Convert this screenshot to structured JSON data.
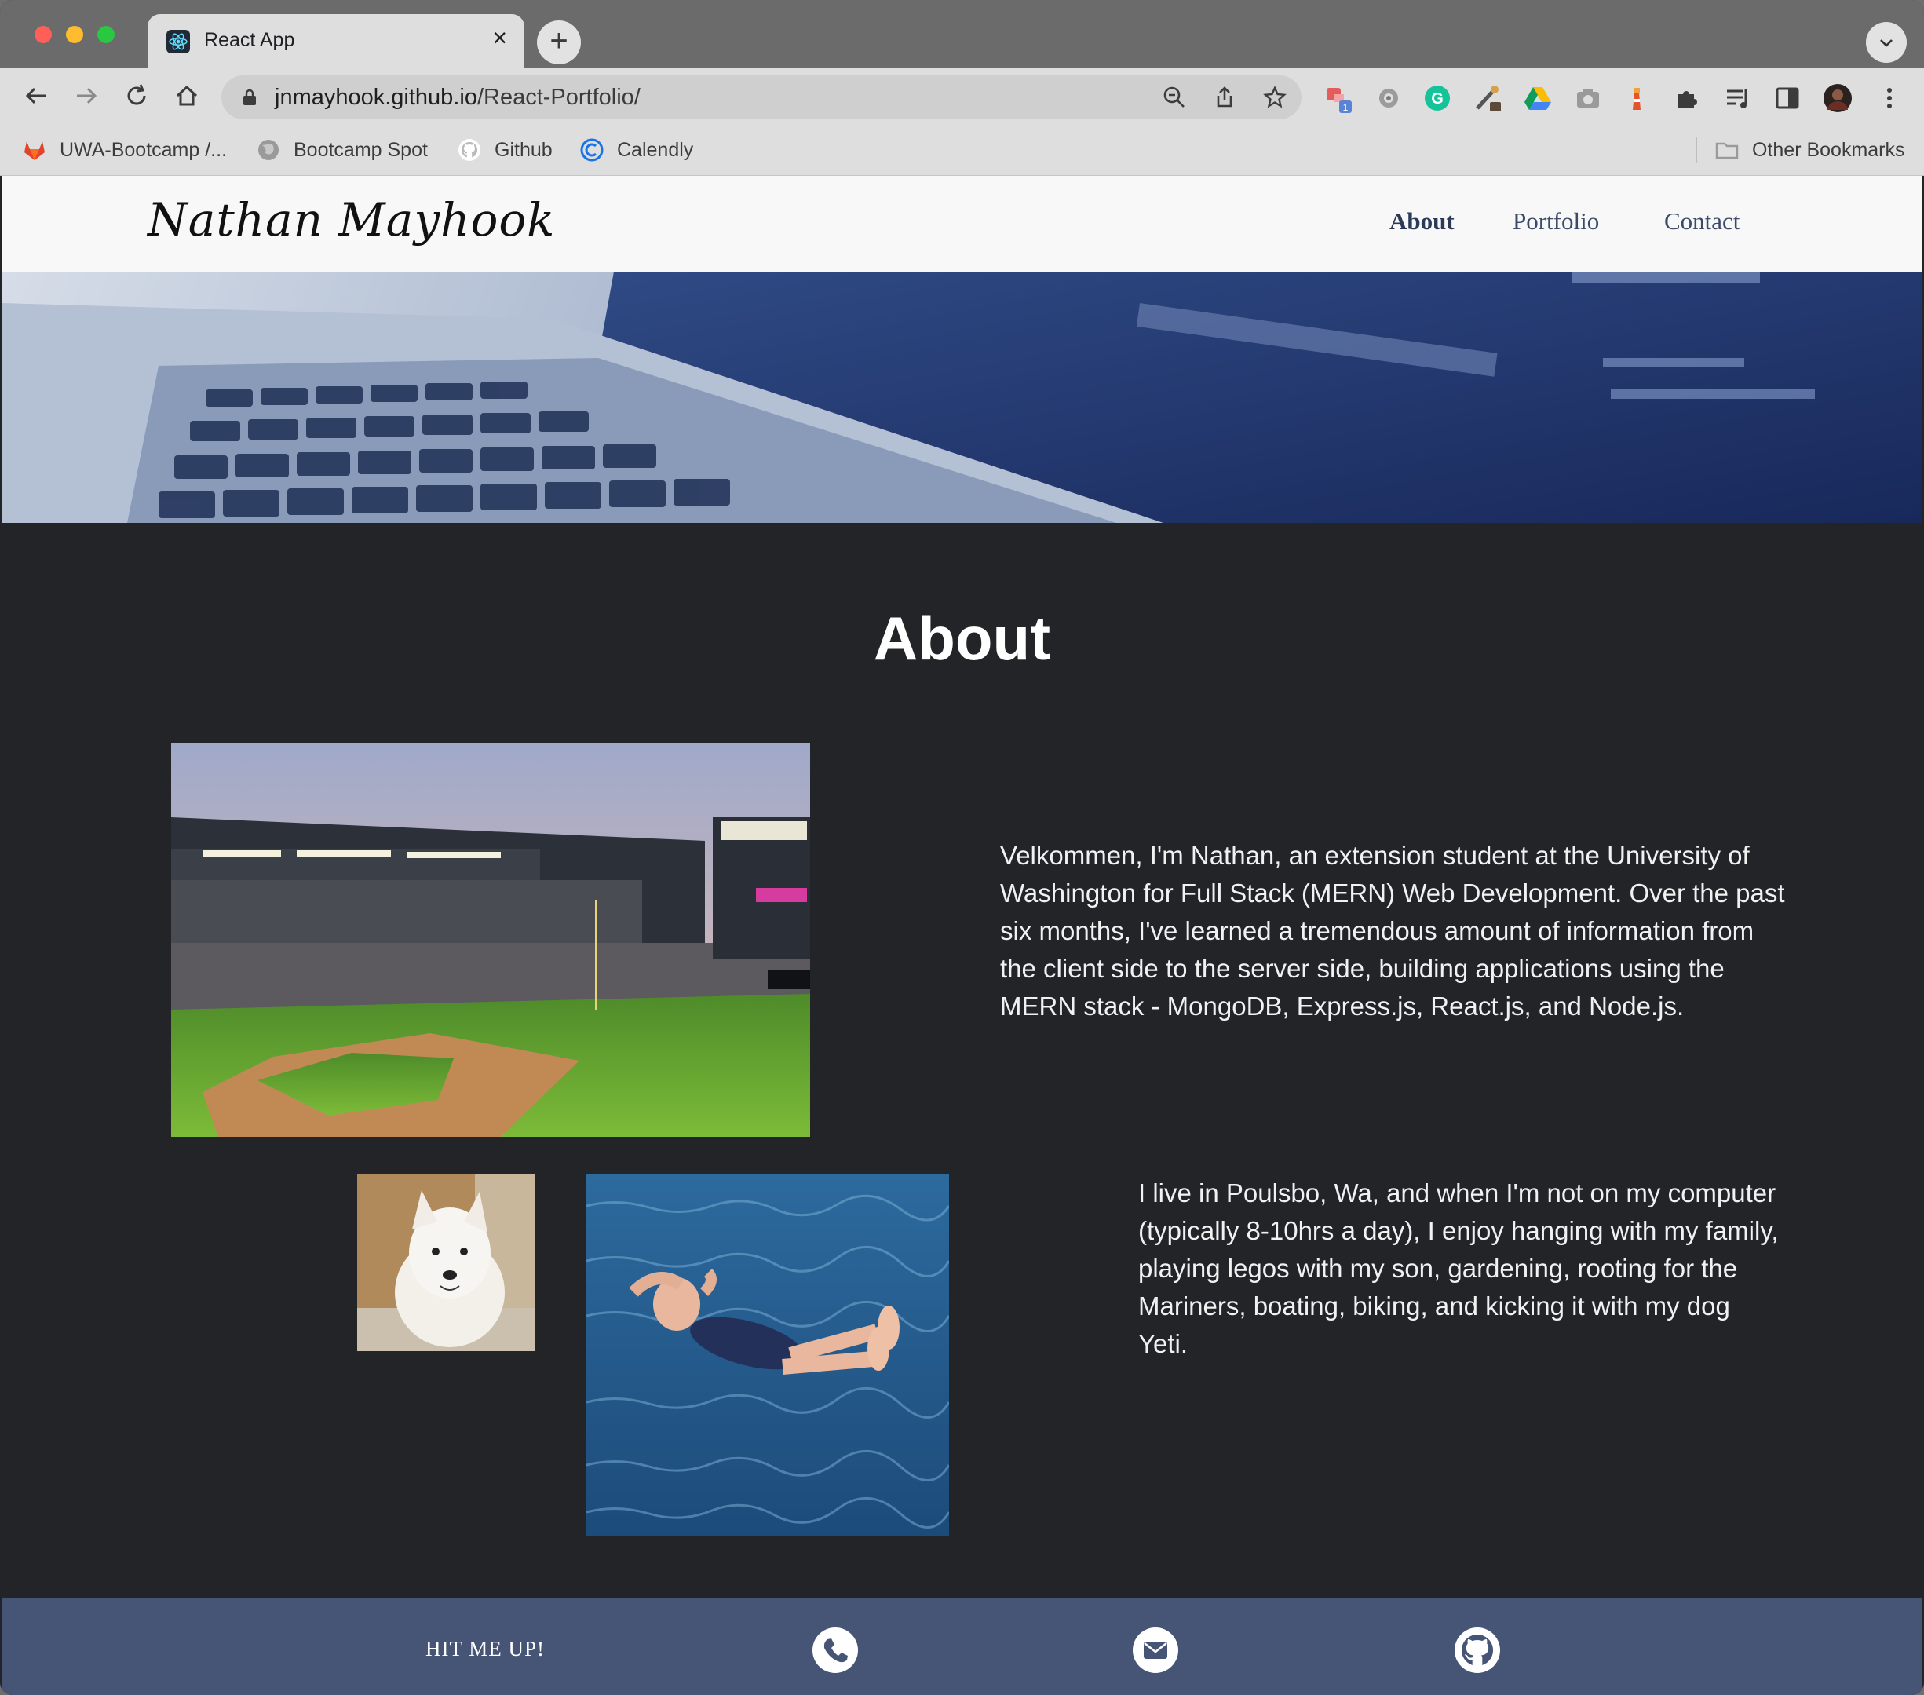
{
  "browser": {
    "tab": {
      "title": "React App"
    },
    "address_bar": {
      "host": "jnmayhook.github.io",
      "path": "/React-Portfolio/"
    },
    "bookmarks": [
      {
        "label": "UWA-Bootcamp /..."
      },
      {
        "label": "Bootcamp Spot"
      },
      {
        "label": "Github"
      },
      {
        "label": "Calendly"
      }
    ],
    "other_bookmarks": "Other Bookmarks",
    "extension_badge": "1"
  },
  "site": {
    "logo": "Nathan Mayhook",
    "nav": [
      {
        "label": "About",
        "active": true
      },
      {
        "label": "Portfolio",
        "active": false
      },
      {
        "label": "Contact",
        "active": false
      }
    ],
    "about": {
      "title": "About",
      "paragraph_1": "Velkommen, I'm Nathan, an extension student at the University of Washington for Full Stack (MERN) Web Development. Over the past six months, I've learned a tremendous amount of information from the client side to the server side, building applications using the MERN stack - MongoDB, Express.js, React.js, and Node.js.",
      "paragraph_2": "I live in Poulsbo, Wa, and when I'm not on my computer (typically 8-10hrs a day), I enjoy hanging with my family, playing legos with my son, gardening, rooting for the Mariners, boating, biking, and kicking it with my dog Yeti."
    },
    "footer": {
      "text": "HIT ME UP!",
      "icons": [
        "phone-icon",
        "email-icon",
        "github-icon"
      ]
    }
  },
  "colors": {
    "page_bg": "#222428",
    "header_bg": "#f8f8f8",
    "footer_bg": "#465575",
    "nav_text": "#3b4a66"
  }
}
